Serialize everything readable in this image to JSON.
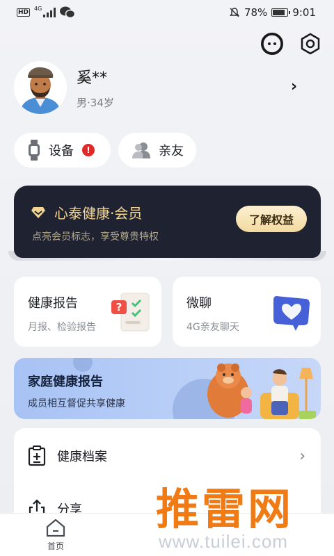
{
  "status_bar": {
    "hd": "HD",
    "network": "4G",
    "battery": "78%",
    "battery_level": 0.78,
    "time": "9:01"
  },
  "profile": {
    "name": "奚**",
    "details": "男·34岁"
  },
  "quick_pills": {
    "device_label": "设备",
    "device_alert": "!",
    "family_label": "亲友"
  },
  "vip": {
    "title": "心泰健康·会员",
    "subtitle": "点亮会员标志，享受尊贵特权",
    "button": "了解权益"
  },
  "cards": {
    "report_title": "健康报告",
    "report_sub": "月报、检验报告",
    "chat_title": "微聊",
    "chat_sub": "4G亲友聊天"
  },
  "banner": {
    "title": "家庭健康报告",
    "subtitle": "成员相互督促共享健康"
  },
  "list": {
    "records_label": "健康档案",
    "share_label": "分享"
  },
  "tabbar": {
    "home_label": "首页"
  },
  "watermark": {
    "text": "推雷网",
    "url": "www.tuilei.com"
  },
  "colors": {
    "vip_bg": "#1f2331",
    "vip_gold": "#f3d492",
    "banner_blue": "#a7c2f4",
    "alert_red": "#e02a2a",
    "watermark_orange": "#f07a14"
  }
}
